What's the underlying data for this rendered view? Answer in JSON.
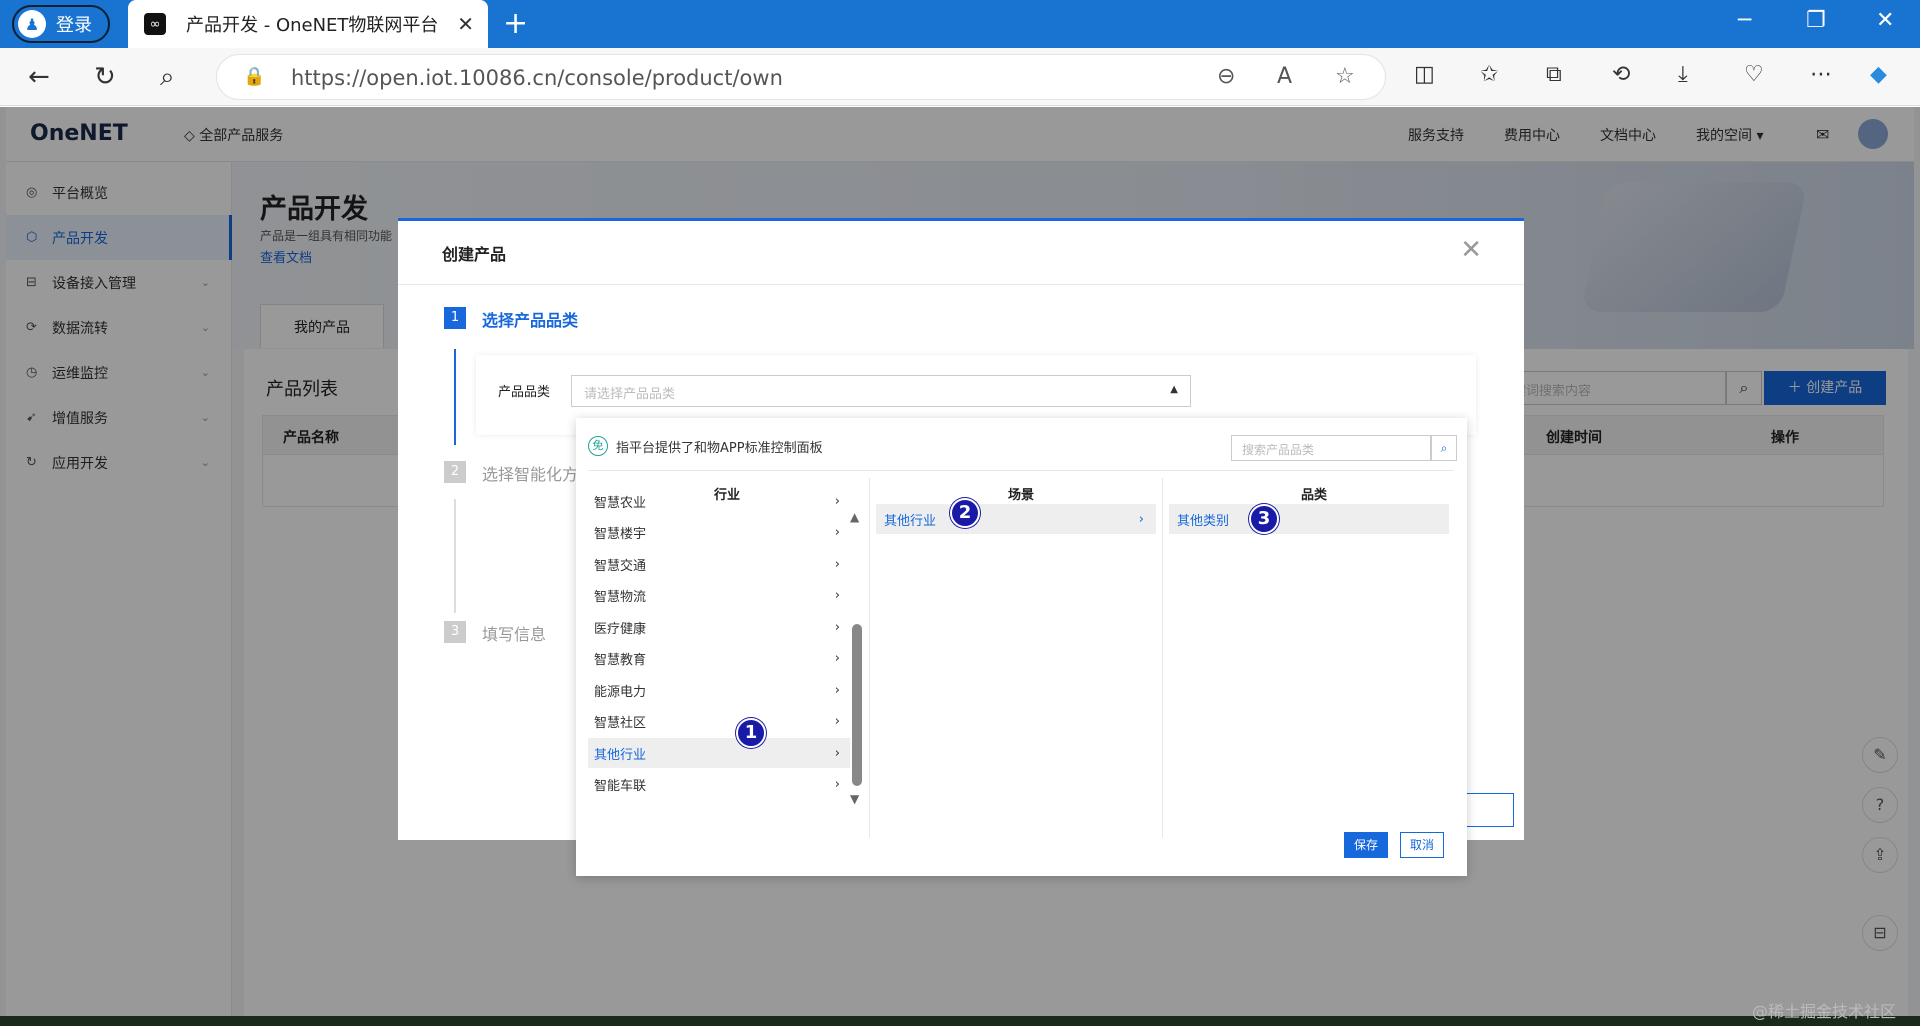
{
  "browser": {
    "profile_label": "登录",
    "tab_title": "产品开发 - OneNET物联网平台",
    "url_host": "https://open.iot.10086.cn",
    "url_path": "/console/product/own"
  },
  "topnav": {
    "logo": "OneNET",
    "all_services": "全部产品服务",
    "links": [
      "服务支持",
      "费用中心",
      "文档中心",
      "我的空间 ▾"
    ]
  },
  "sidebar": {
    "items": [
      {
        "label": "平台概览",
        "icon": "overview-icon"
      },
      {
        "label": "产品开发",
        "icon": "product-icon"
      },
      {
        "label": "设备接入管理",
        "icon": "device-icon"
      },
      {
        "label": "数据流转",
        "icon": "dataflow-icon"
      },
      {
        "label": "运维监控",
        "icon": "monitor-icon"
      },
      {
        "label": "增值服务",
        "icon": "value-icon"
      },
      {
        "label": "应用开发",
        "icon": "app-icon"
      }
    ]
  },
  "page": {
    "title": "产品开发",
    "desc": "产品是一组具有相同功能",
    "doc_link": "查看文档",
    "tab_my_products": "我的产品",
    "list_title": "产品列表",
    "search_placeholder": "键词搜索内容",
    "create_button": "＋ 创建产品",
    "columns": [
      "产品名称",
      "创建时间",
      "操作"
    ]
  },
  "modal": {
    "title": "创建产品",
    "steps": [
      {
        "num": "1",
        "label": "选择产品品类"
      },
      {
        "num": "2",
        "label": "选择智能化方"
      },
      {
        "num": "3",
        "label": "填写信息"
      }
    ],
    "category_label": "产品品类",
    "category_placeholder": "请选择产品品类"
  },
  "dropdown": {
    "info": "指平台提供了和物APP标准控制面板",
    "info_icon_char": "免",
    "search_placeholder": "搜索产品品类",
    "col_headers": [
      "行业",
      "场景",
      "品类"
    ],
    "industries": [
      "智慧农业",
      "智慧楼宇",
      "智慧交通",
      "智慧物流",
      "医疗健康",
      "智慧教育",
      "能源电力",
      "智慧社区",
      "其他行业",
      "智能车联"
    ],
    "selected_industry_index": 8,
    "scene": "其他行业",
    "category": "其他类别",
    "save": "保存",
    "cancel": "取消",
    "badges": [
      "1",
      "2",
      "3"
    ]
  },
  "watermark": "@稀土掘金技术社区"
}
